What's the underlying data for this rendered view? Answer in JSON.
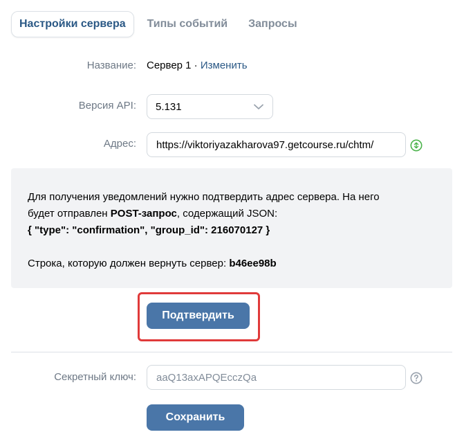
{
  "tabs": [
    {
      "label": "Настройки сервера",
      "active": true
    },
    {
      "label": "Типы событий",
      "active": false
    },
    {
      "label": "Запросы",
      "active": false
    }
  ],
  "form": {
    "name_label": "Название:",
    "name_value": "Сервер 1",
    "name_separator": " · ",
    "change_link": "Изменить",
    "api_label": "Версия API:",
    "api_value": "5.131",
    "address_label": "Адрес:",
    "address_value": "https://viktoriyazakharova97.getcourse.ru/chtm/",
    "secret_label": "Секретный ключ:",
    "secret_placeholder": "aaQ13axAPQEcczQa",
    "save_label": "Сохранить"
  },
  "confirmation": {
    "line1": "Для получения уведомлений нужно подтвердить адрес сервера. На него",
    "line2_prefix": "будет отправлен ",
    "line2_bold": "POST-запрос",
    "line2_suffix": ", содержащий JSON:",
    "json": "{ \"type\": \"confirmation\", \"group_id\": 216070127 }",
    "return_prefix": "Строка, которую должен вернуть сервер: ",
    "return_value": "b46ee98b",
    "confirm_label": "Подтвердить"
  },
  "colors": {
    "accent": "#4a76a8",
    "link": "#2a5885",
    "success": "#4bb34b",
    "highlight": "#e03a3a"
  },
  "icons": {
    "api_dropdown": "chevron-down-icon",
    "address_status": "status-check-icon",
    "secret_help": "question-icon"
  }
}
